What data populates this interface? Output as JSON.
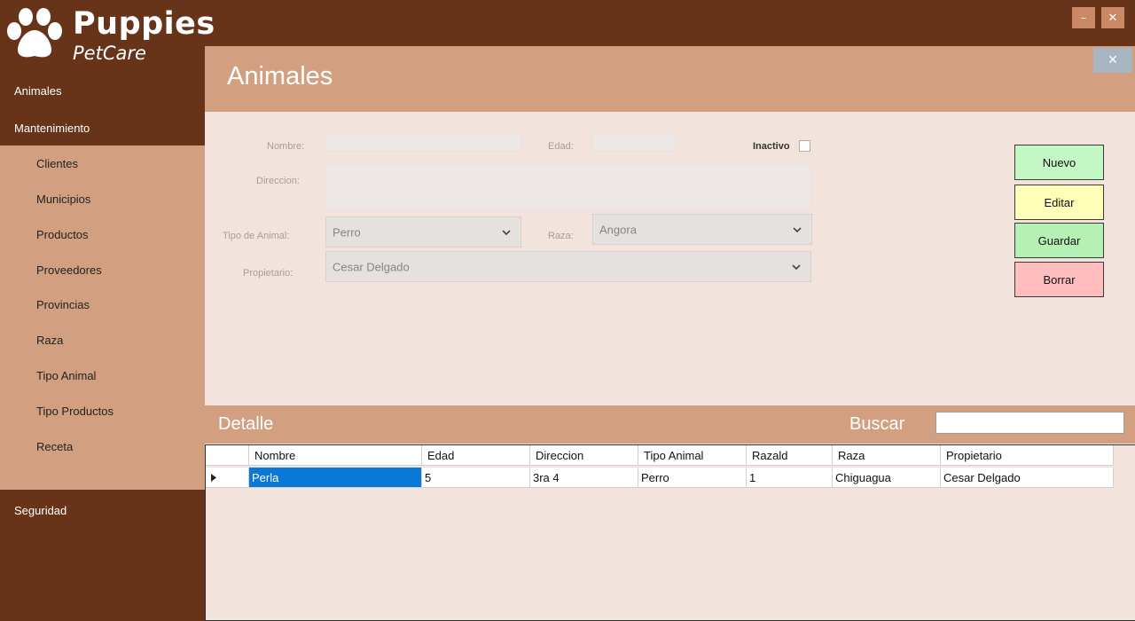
{
  "window": {
    "minimize_glyph": "–",
    "close_glyph": "✕"
  },
  "brand": {
    "title": "Puppies",
    "subtitle": "PetCare",
    "logo_icon": "paw-icon"
  },
  "nav": {
    "animales": "Animales",
    "mantenimiento": "Mantenimiento",
    "seguridad": "Seguridad",
    "submenu": [
      "Clientes",
      "Municipios",
      "Productos",
      "Proveedores",
      "Provincias",
      "Raza",
      "Tipo Animal",
      "Tipo Productos",
      "Receta"
    ]
  },
  "header": {
    "title": "Animales",
    "close_glyph": "✕"
  },
  "form": {
    "nombre_label": "Nombre:",
    "edad_label": "Edad:",
    "inactivo_label": "Inactivo",
    "direccion_label": "Direccion:",
    "tipo_animal_label": "Tipo de Animal:",
    "tipo_animal_value": "Perro",
    "raza_label": "Raza:",
    "raza_value": "Angora",
    "propietario_label": "Propietario:",
    "propietario_value": "Cesar Delgado"
  },
  "actions": {
    "nuevo": "Nuevo",
    "editar": "Editar",
    "guardar": "Guardar",
    "borrar": "Borrar"
  },
  "detail": {
    "title": "Detalle",
    "search_label": "Buscar",
    "search_value": ""
  },
  "grid": {
    "columns": [
      "Nombre",
      "Edad",
      "Direccion",
      "Tipo Animal",
      "Razald",
      "Raza",
      "Propietario"
    ],
    "rows": [
      [
        "Perla",
        "5",
        "3ra 4",
        "Perro",
        "1",
        "Chiguagua",
        "Cesar Delgado"
      ]
    ]
  },
  "colors": {
    "sidebar": "#67341a",
    "accent": "#d2a080",
    "panel": "#f2e4dc",
    "nuevo": "#c3f7c3",
    "editar": "#ffffb8",
    "guardar": "#b5f0b5",
    "borrar": "#ffbdbd",
    "selection": "#0a78d7"
  }
}
